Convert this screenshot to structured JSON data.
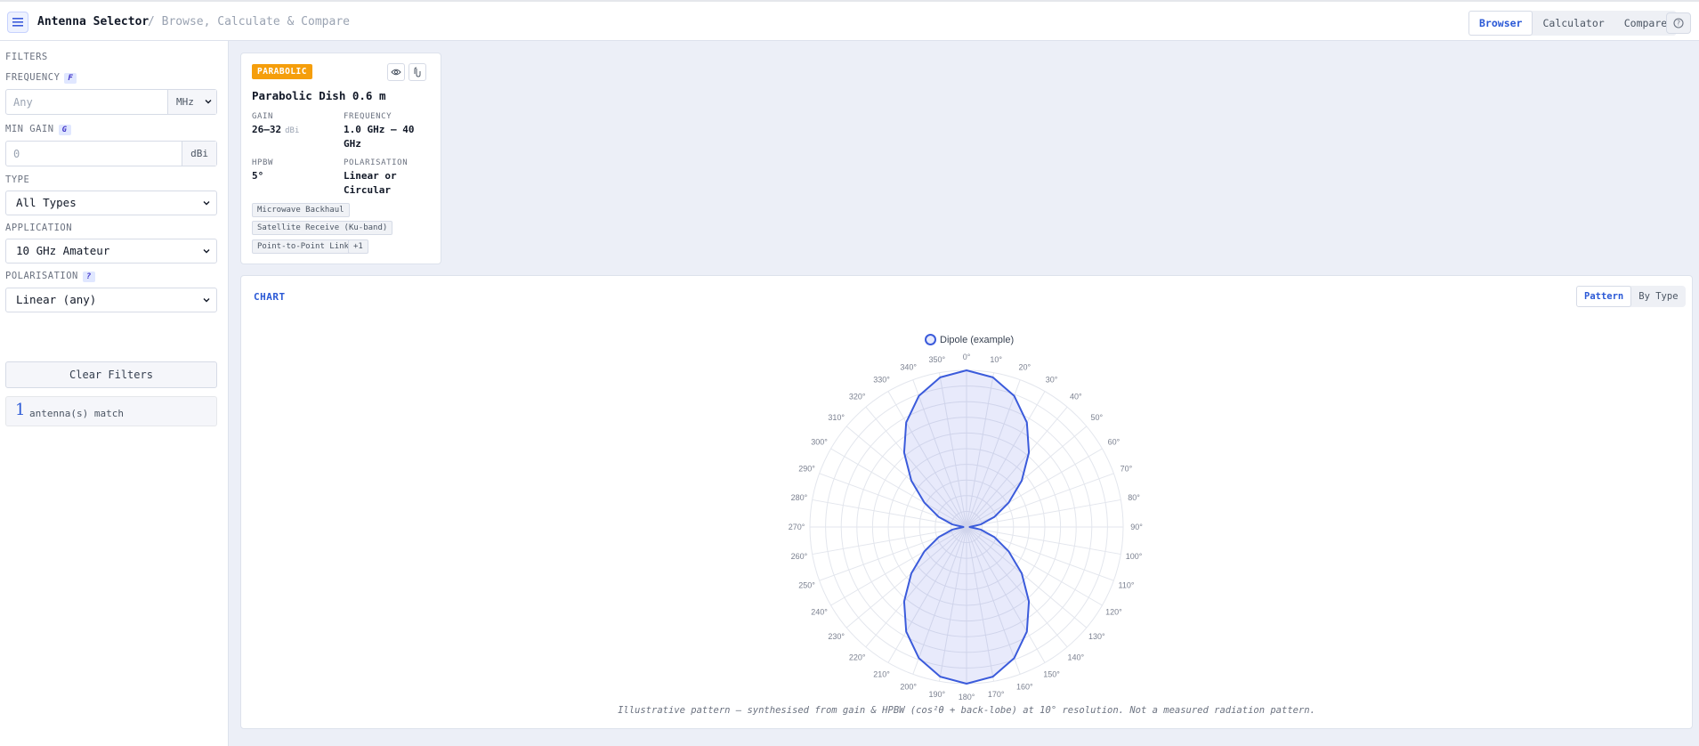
{
  "header": {
    "title": "Antenna Selector",
    "subtitle": "/ Browse, Calculate & Compare",
    "tabs": [
      {
        "label": "Browser",
        "active": true
      },
      {
        "label": "Calculator",
        "active": false
      },
      {
        "label": "Compare",
        "active": false
      }
    ]
  },
  "sidebar": {
    "heading": "FILTERS",
    "frequency": {
      "label": "FREQUENCY",
      "key": "F",
      "placeholder": "Any",
      "value": "",
      "unit": "MHz"
    },
    "min_gain": {
      "label": "MIN GAIN",
      "key": "G",
      "placeholder": "0",
      "value": "",
      "unit": "dBi"
    },
    "type": {
      "label": "TYPE",
      "selected": "All Types"
    },
    "application": {
      "label": "APPLICATION",
      "selected": "10 GHz Amateur"
    },
    "polarisation": {
      "label": "POLARISATION",
      "key": "?",
      "selected": "Linear (any)"
    },
    "clear_label": "Clear Filters",
    "match_count": "1",
    "match_text": "antenna(s) match"
  },
  "card": {
    "badge": "PARABOLIC",
    "badge_color": "#f59e0b",
    "name": "Parabolic Dish 0.6 m",
    "gain_label": "GAIN",
    "gain_value": "26–32",
    "gain_unit": "dBi",
    "frequency_label": "FREQUENCY",
    "frequency_value_1": "1.0 GHz – 40",
    "frequency_value_2": "GHz",
    "hpbw_label": "HPBW",
    "hpbw_value": "5°",
    "polarisation_label": "POLARISATION",
    "polarisation_value_1": "Linear or",
    "polarisation_value_2": "Circular",
    "tags": [
      "Microwave Backhaul",
      "Satellite Receive (Ku-band)",
      "Point-to-Point Link",
      "+1"
    ],
    "icons": [
      "eye-icon",
      "link-icon"
    ]
  },
  "chart_panel": {
    "title": "CHART",
    "toggle": [
      {
        "label": "Pattern",
        "active": true
      },
      {
        "label": "By Type",
        "active": false
      }
    ],
    "caption": "Illustrative pattern — synthesised from gain & HPBW (cos²θ + back-lobe) at 10° resolution. Not a measured radiation pattern."
  },
  "chart_data": {
    "type": "radar",
    "series": [
      {
        "name": "Dipole (example)",
        "color": "#3b5bdb",
        "angles": [
          0,
          10,
          20,
          30,
          40,
          50,
          60,
          70,
          80,
          90,
          100,
          110,
          120,
          130,
          140,
          150,
          160,
          170,
          180,
          190,
          200,
          210,
          220,
          230,
          240,
          250,
          260,
          270,
          280,
          290,
          300,
          310,
          320,
          330,
          340,
          350
        ],
        "values": [
          1.0,
          0.97,
          0.89,
          0.77,
          0.62,
          0.46,
          0.31,
          0.19,
          0.09,
          0.02,
          0.09,
          0.19,
          0.31,
          0.46,
          0.62,
          0.77,
          0.89,
          0.97,
          1.0,
          0.97,
          0.89,
          0.77,
          0.62,
          0.46,
          0.31,
          0.19,
          0.09,
          0.02,
          0.09,
          0.19,
          0.31,
          0.46,
          0.62,
          0.77,
          0.89,
          0.97
        ]
      }
    ],
    "angle_labels": [
      "0°",
      "10°",
      "20°",
      "30°",
      "40°",
      "50°",
      "60°",
      "70°",
      "80°",
      "90°",
      "100°",
      "110°",
      "120°",
      "130°",
      "140°",
      "150°",
      "160°",
      "170°",
      "180°",
      "190°",
      "200°",
      "210°",
      "220°",
      "230°",
      "240°",
      "250°",
      "260°",
      "270°",
      "280°",
      "290°",
      "300°",
      "310°",
      "320°",
      "330°",
      "340°",
      "350°"
    ],
    "rlim": [
      0,
      1
    ],
    "grid": true,
    "legend": "top"
  }
}
